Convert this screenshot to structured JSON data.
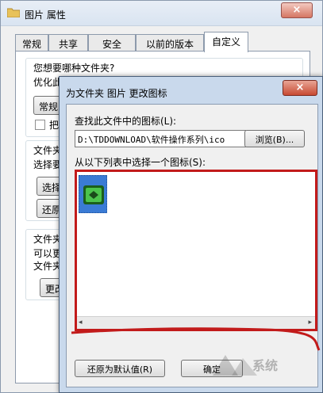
{
  "colors": {
    "accent": "#3a7bd5",
    "highlight_box": "#c21b1b",
    "title_bar": "#c9d9ec"
  },
  "back_window": {
    "title": "图片 属性",
    "close_glyph": "×",
    "tabs": [
      "常规",
      "共享",
      "安全",
      "以前的版本",
      "自定义"
    ],
    "active_tab": "自定义",
    "question": "您想要哪种文件夹?",
    "optimize_prefix": "优化此",
    "btn_general": "常规",
    "check_text": "把",
    "folder_picture_prefix": "文件夹",
    "select_prefix": "选择要",
    "btn_select": "选择",
    "btn_restore": "还原",
    "folder_icon_prefix": "文件夹",
    "can_change": "可以更",
    "folder_text": "文件夹",
    "btn_change": "更改"
  },
  "dialog": {
    "title": "为文件夹 图片 更改图标",
    "close_glyph": "×",
    "find_label": "查找此文件中的图标(L):",
    "path_value": "D:\\TDDOWNLOAD\\软件操作系列\\ico",
    "browse_label": "浏览(B)...",
    "list_label": "从以下列表中选择一个图标(S):",
    "icon_name": "green-folder-icon",
    "restore_label": "还原为默认值(R)",
    "ok_label": "确定",
    "scroll_left": "◂",
    "scroll_right": "▸"
  },
  "watermark": {
    "text": "系统"
  }
}
